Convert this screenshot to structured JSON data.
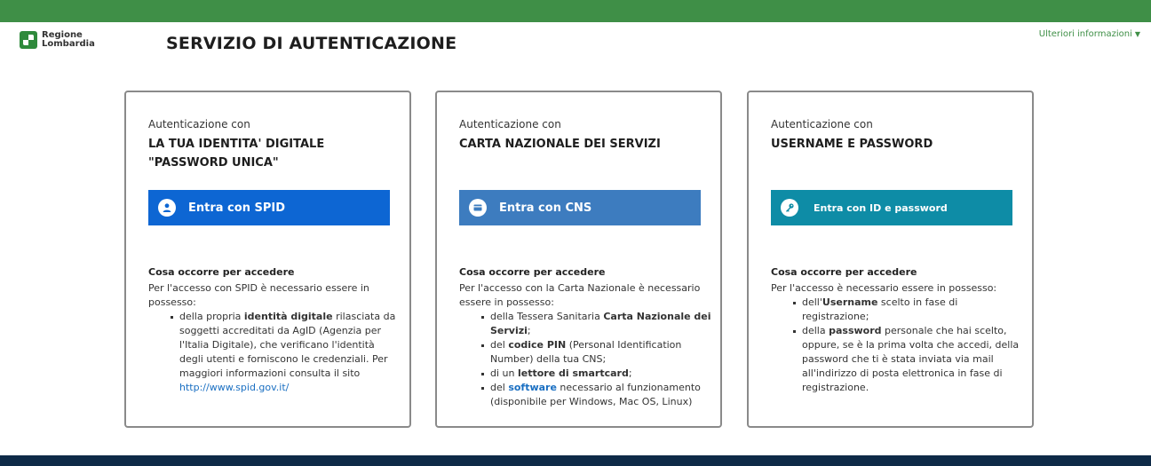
{
  "header": {
    "logo_line1": "Regione",
    "logo_line2": "Lombardia",
    "title": "SERVIZIO DI AUTENTICAZIONE",
    "more_info": "Ulteriori informazioni",
    "colors": {
      "top_stripe": "#3f8f47",
      "bottom_bar": "#0e2a47"
    }
  },
  "cards": [
    {
      "eyebrow": "Autenticazione con",
      "method": "LA TUA IDENTITA' DIGITALE \"PASSWORD UNICA\"",
      "button_label": "Entra con SPID",
      "button_icon": "user-icon",
      "button_color": "#0d66d3",
      "req_title": "Cosa occorre per accedere",
      "req_intro": "Per l'accesso con SPID è necessario essere in possesso:",
      "items": [
        {
          "pre": "della propria ",
          "bold": "identità digitale",
          "post": " rilasciata da soggetti accreditati da AgID (Agenzia per l'Italia Digitale), che verificano l'identità degli utenti e forniscono le credenziali. Per maggiori informazioni consulta il sito ",
          "link": "http://www.spid.gov.it/"
        }
      ]
    },
    {
      "eyebrow": "Autenticazione con",
      "method": "CARTA NAZIONALE DEI SERVIZI",
      "button_label": "Entra con CNS",
      "button_icon": "card-icon",
      "button_color": "#3d7cbf",
      "req_title": "Cosa occorre per accedere",
      "req_intro": "Per l'accesso con la Carta Nazionale è necessario essere in possesso:",
      "items": [
        {
          "pre": "della Tessera Sanitaria ",
          "bold": "Carta Nazionale dei Servizi",
          "post": ";"
        },
        {
          "pre": "del ",
          "bold": "codice PIN",
          "post": " (Personal Identification Number) della tua CNS;"
        },
        {
          "pre": "di un ",
          "bold": "lettore di smartcard",
          "post": ";"
        },
        {
          "pre": "del ",
          "link_bold": "software",
          "post": " necessario al funzionamento (disponibile per Windows, Mac OS, Linux)"
        }
      ]
    },
    {
      "eyebrow": "Autenticazione con",
      "method": "USERNAME E PASSWORD",
      "button_label": "Entra con ID e password",
      "button_icon": "key-icon",
      "button_color": "#0e8ca6",
      "req_title": "Cosa occorre per accedere",
      "req_intro": "Per l'accesso è necessario essere in possesso:",
      "items": [
        {
          "pre": "dell'",
          "bold": "Username",
          "post": " scelto in fase di registrazione;"
        },
        {
          "pre": "della ",
          "bold": "password",
          "post": " personale che hai scelto, oppure, se è la prima volta che accedi, della password che ti è stata inviata via mail all'indirizzo di posta elettronica in fase di registrazione."
        }
      ]
    }
  ]
}
